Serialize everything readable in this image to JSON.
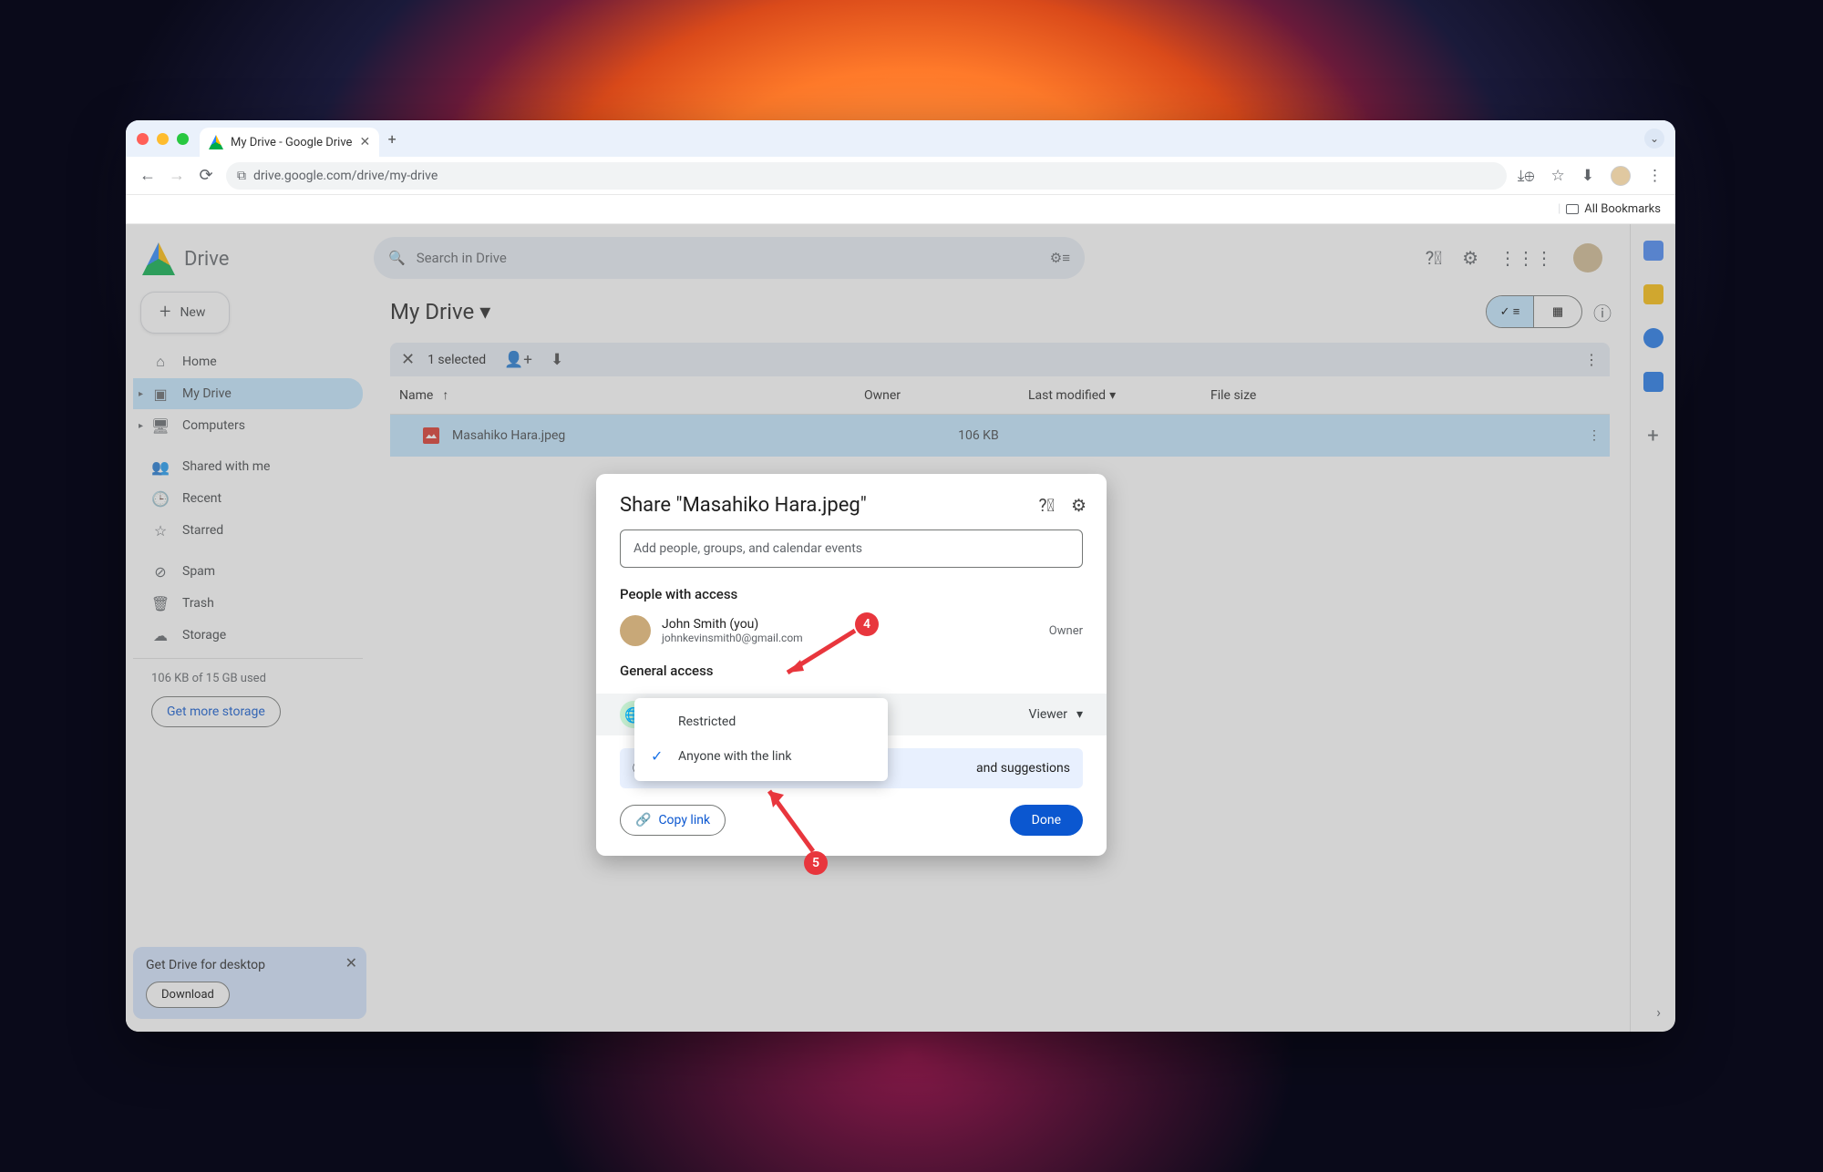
{
  "browser": {
    "tab_title": "My Drive - Google Drive",
    "url": "drive.google.com/drive/my-drive",
    "bookmarks": "All Bookmarks"
  },
  "drive": {
    "brand": "Drive",
    "new_btn": "New",
    "search_placeholder": "Search in Drive",
    "nav": {
      "home": "Home",
      "my_drive": "My Drive",
      "computers": "Computers",
      "shared": "Shared with me",
      "recent": "Recent",
      "starred": "Starred",
      "spam": "Spam",
      "trash": "Trash",
      "storage": "Storage"
    },
    "storage_used": "106 KB of 15 GB used",
    "get_more": "Get more storage",
    "desktop_promo": {
      "title": "Get Drive for desktop",
      "download": "Download"
    }
  },
  "main": {
    "breadcrumb": "My Drive",
    "selected_chip": "1 selected",
    "columns": {
      "name": "Name",
      "owner": "Owner",
      "modified": "Last modified",
      "size": "File size"
    },
    "row": {
      "filename": "Masahiko Hara.jpeg",
      "size": "106 KB"
    }
  },
  "dialog": {
    "title": "Share \"Masahiko Hara.jpeg\"",
    "input_placeholder": "Add people, groups, and calendar events",
    "people_with_access": "People with access",
    "owner_name": "John Smith (you)",
    "owner_email": "johnkevinsmith0@gmail.com",
    "owner_role": "Owner",
    "general_access": "General access",
    "access_option": "Anyone with the link",
    "viewer": "Viewer",
    "banner_tail": "and suggestions",
    "copy_link": "Copy link",
    "done": "Done",
    "dropdown": {
      "restricted": "Restricted",
      "anyone": "Anyone with the link"
    }
  },
  "markers": {
    "m4": "4",
    "m5": "5"
  }
}
